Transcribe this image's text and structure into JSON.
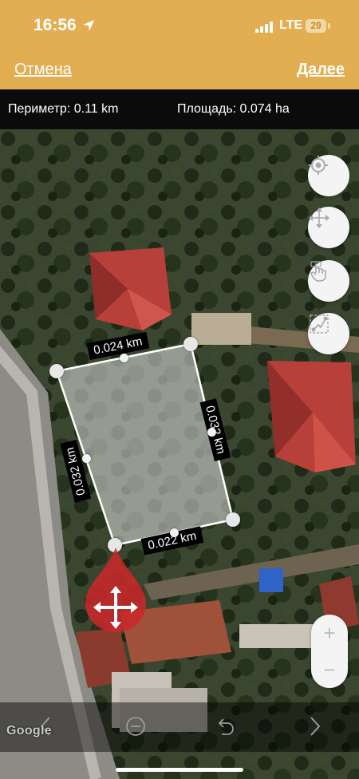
{
  "status": {
    "time": "16:56",
    "network": "LTE",
    "battery": "29"
  },
  "nav": {
    "cancel_label": "Отмена",
    "next_label": "Далее"
  },
  "info": {
    "perimeter": "Периметр: 0.11 km",
    "area": "Площадь: 0.074 ha"
  },
  "map": {
    "segment_labels": [
      "0.024 km",
      "0.032 km",
      "0.022 km",
      "0.032 km"
    ],
    "attribution": "Google",
    "colors": {
      "header": "#e3ad52",
      "pin": "#c8282a",
      "roof": "#b8403a"
    }
  },
  "toolbar": {
    "icons": [
      "back-icon",
      "minus-circle-icon",
      "undo-icon",
      "forward-icon"
    ]
  },
  "side_buttons": [
    "locate-icon",
    "move-icon",
    "tap-hand-icon",
    "draw-path-icon"
  ],
  "zoom": {
    "in": "+",
    "out": "−"
  }
}
